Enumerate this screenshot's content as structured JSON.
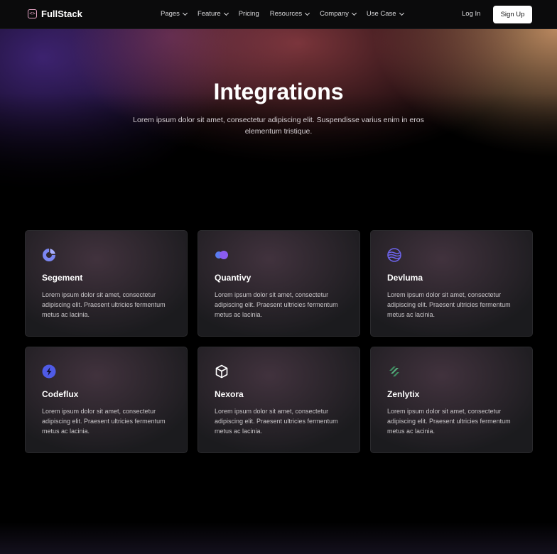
{
  "nav": {
    "brand": "FullStack",
    "links": [
      {
        "label": "Pages",
        "dropdown": true
      },
      {
        "label": "Feature",
        "dropdown": true
      },
      {
        "label": "Pricing",
        "dropdown": false
      },
      {
        "label": "Resources",
        "dropdown": true
      },
      {
        "label": "Company",
        "dropdown": true
      },
      {
        "label": "Use Case",
        "dropdown": true
      }
    ],
    "login": "Log In",
    "signup": "Sign Up"
  },
  "hero": {
    "title": "Integrations",
    "subtitle": "Lorem ipsum dolor sit amet, consectetur adipiscing elit. Suspendisse varius enim in eros elementum tristique."
  },
  "integrations": [
    {
      "name": "Segement",
      "icon": "segement-logo-icon",
      "color": "#7b86f2",
      "description": "Lorem ipsum dolor sit amet, consectetur adipiscing elit. Praesent ultricies fermentum metus ac lacinia."
    },
    {
      "name": "Quantivy",
      "icon": "quantivy-logo-icon",
      "color": "#8a5cf0",
      "description": "Lorem ipsum dolor sit amet, consectetur adipiscing elit. Praesent ultricies fermentum metus ac lacinia."
    },
    {
      "name": "Devluma",
      "icon": "devluma-logo-icon",
      "color": "#6c63e8",
      "description": "Lorem ipsum dolor sit amet, consectetur adipiscing elit. Praesent ultricies fermentum metus ac lacinia."
    },
    {
      "name": "Codeflux",
      "icon": "codeflux-logo-icon",
      "color": "#4f5be6",
      "description": "Lorem ipsum dolor sit amet, consectetur adipiscing elit. Praesent ultricies fermentum metus ac lacinia."
    },
    {
      "name": "Nexora",
      "icon": "nexora-logo-icon",
      "color": "#ffffff",
      "description": "Lorem ipsum dolor sit amet, consectetur adipiscing elit. Praesent ultricies fermentum metus ac lacinia."
    },
    {
      "name": "Zenlytix",
      "icon": "zenlytix-logo-icon",
      "color": "#3f8f63",
      "description": "Lorem ipsum dolor sit amet, consectetur adipiscing elit. Praesent ultricies fermentum metus ac lacinia."
    }
  ]
}
